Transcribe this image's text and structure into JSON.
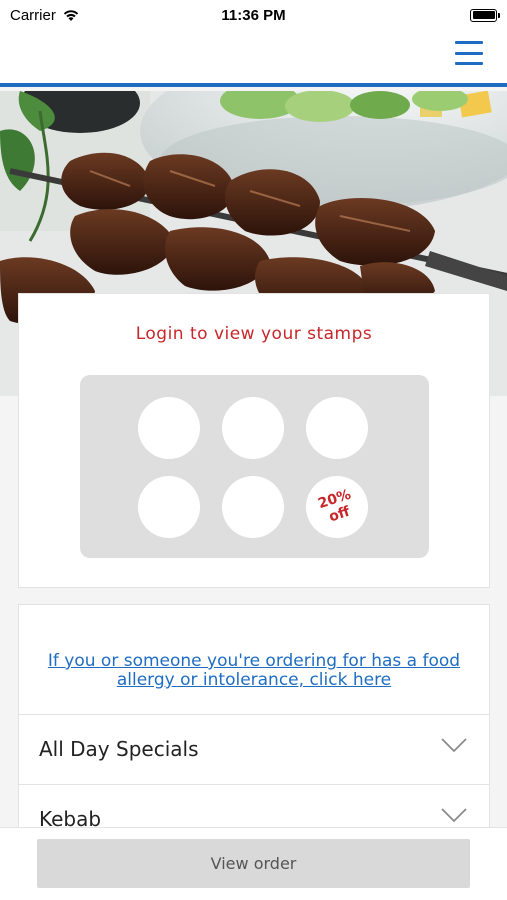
{
  "status_bar": {
    "carrier": "Carrier",
    "time": "11:36 PM"
  },
  "stamp_card": {
    "title": "Login to view your stamps",
    "reward_text": "20% off",
    "stamps_total": 6
  },
  "menu": {
    "allergy_link": "If you or someone you're ordering for has a food allergy or intolerance, click here",
    "categories": [
      {
        "label": "All Day Specials"
      },
      {
        "label": "Kebab"
      }
    ]
  },
  "footer": {
    "view_order_label": "View order"
  },
  "colors": {
    "accent_blue": "#1f6dc2",
    "accent_red": "#c8262b"
  }
}
